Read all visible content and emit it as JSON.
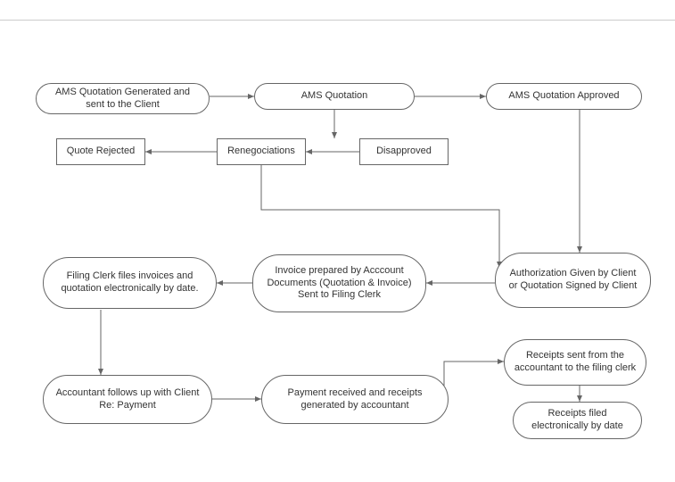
{
  "nodes": {
    "n1": "AMS Quotation Generated and sent to the Client",
    "n2": "AMS Quotation",
    "n3": "AMS Quotation Approved",
    "n4": "Quote Rejected",
    "n5": "Renegociations",
    "n6": "Disapproved",
    "n7": "Authorization Given by Client\nor\nQuotation Signed by Client",
    "n8": "Invoice prepared by Acccount Documents\n(Quotation & Invoice)\nSent to Filing Clerk",
    "n9": "Filing Clerk files invoices and quotation electronically by date.",
    "n10": "Accountant follows up with Client Re: Payment",
    "n11": "Payment received and receipts generated by accountant",
    "n12": "Receipts sent from the accountant to the filing clerk",
    "n13": "Receipts filed electronically by date"
  }
}
